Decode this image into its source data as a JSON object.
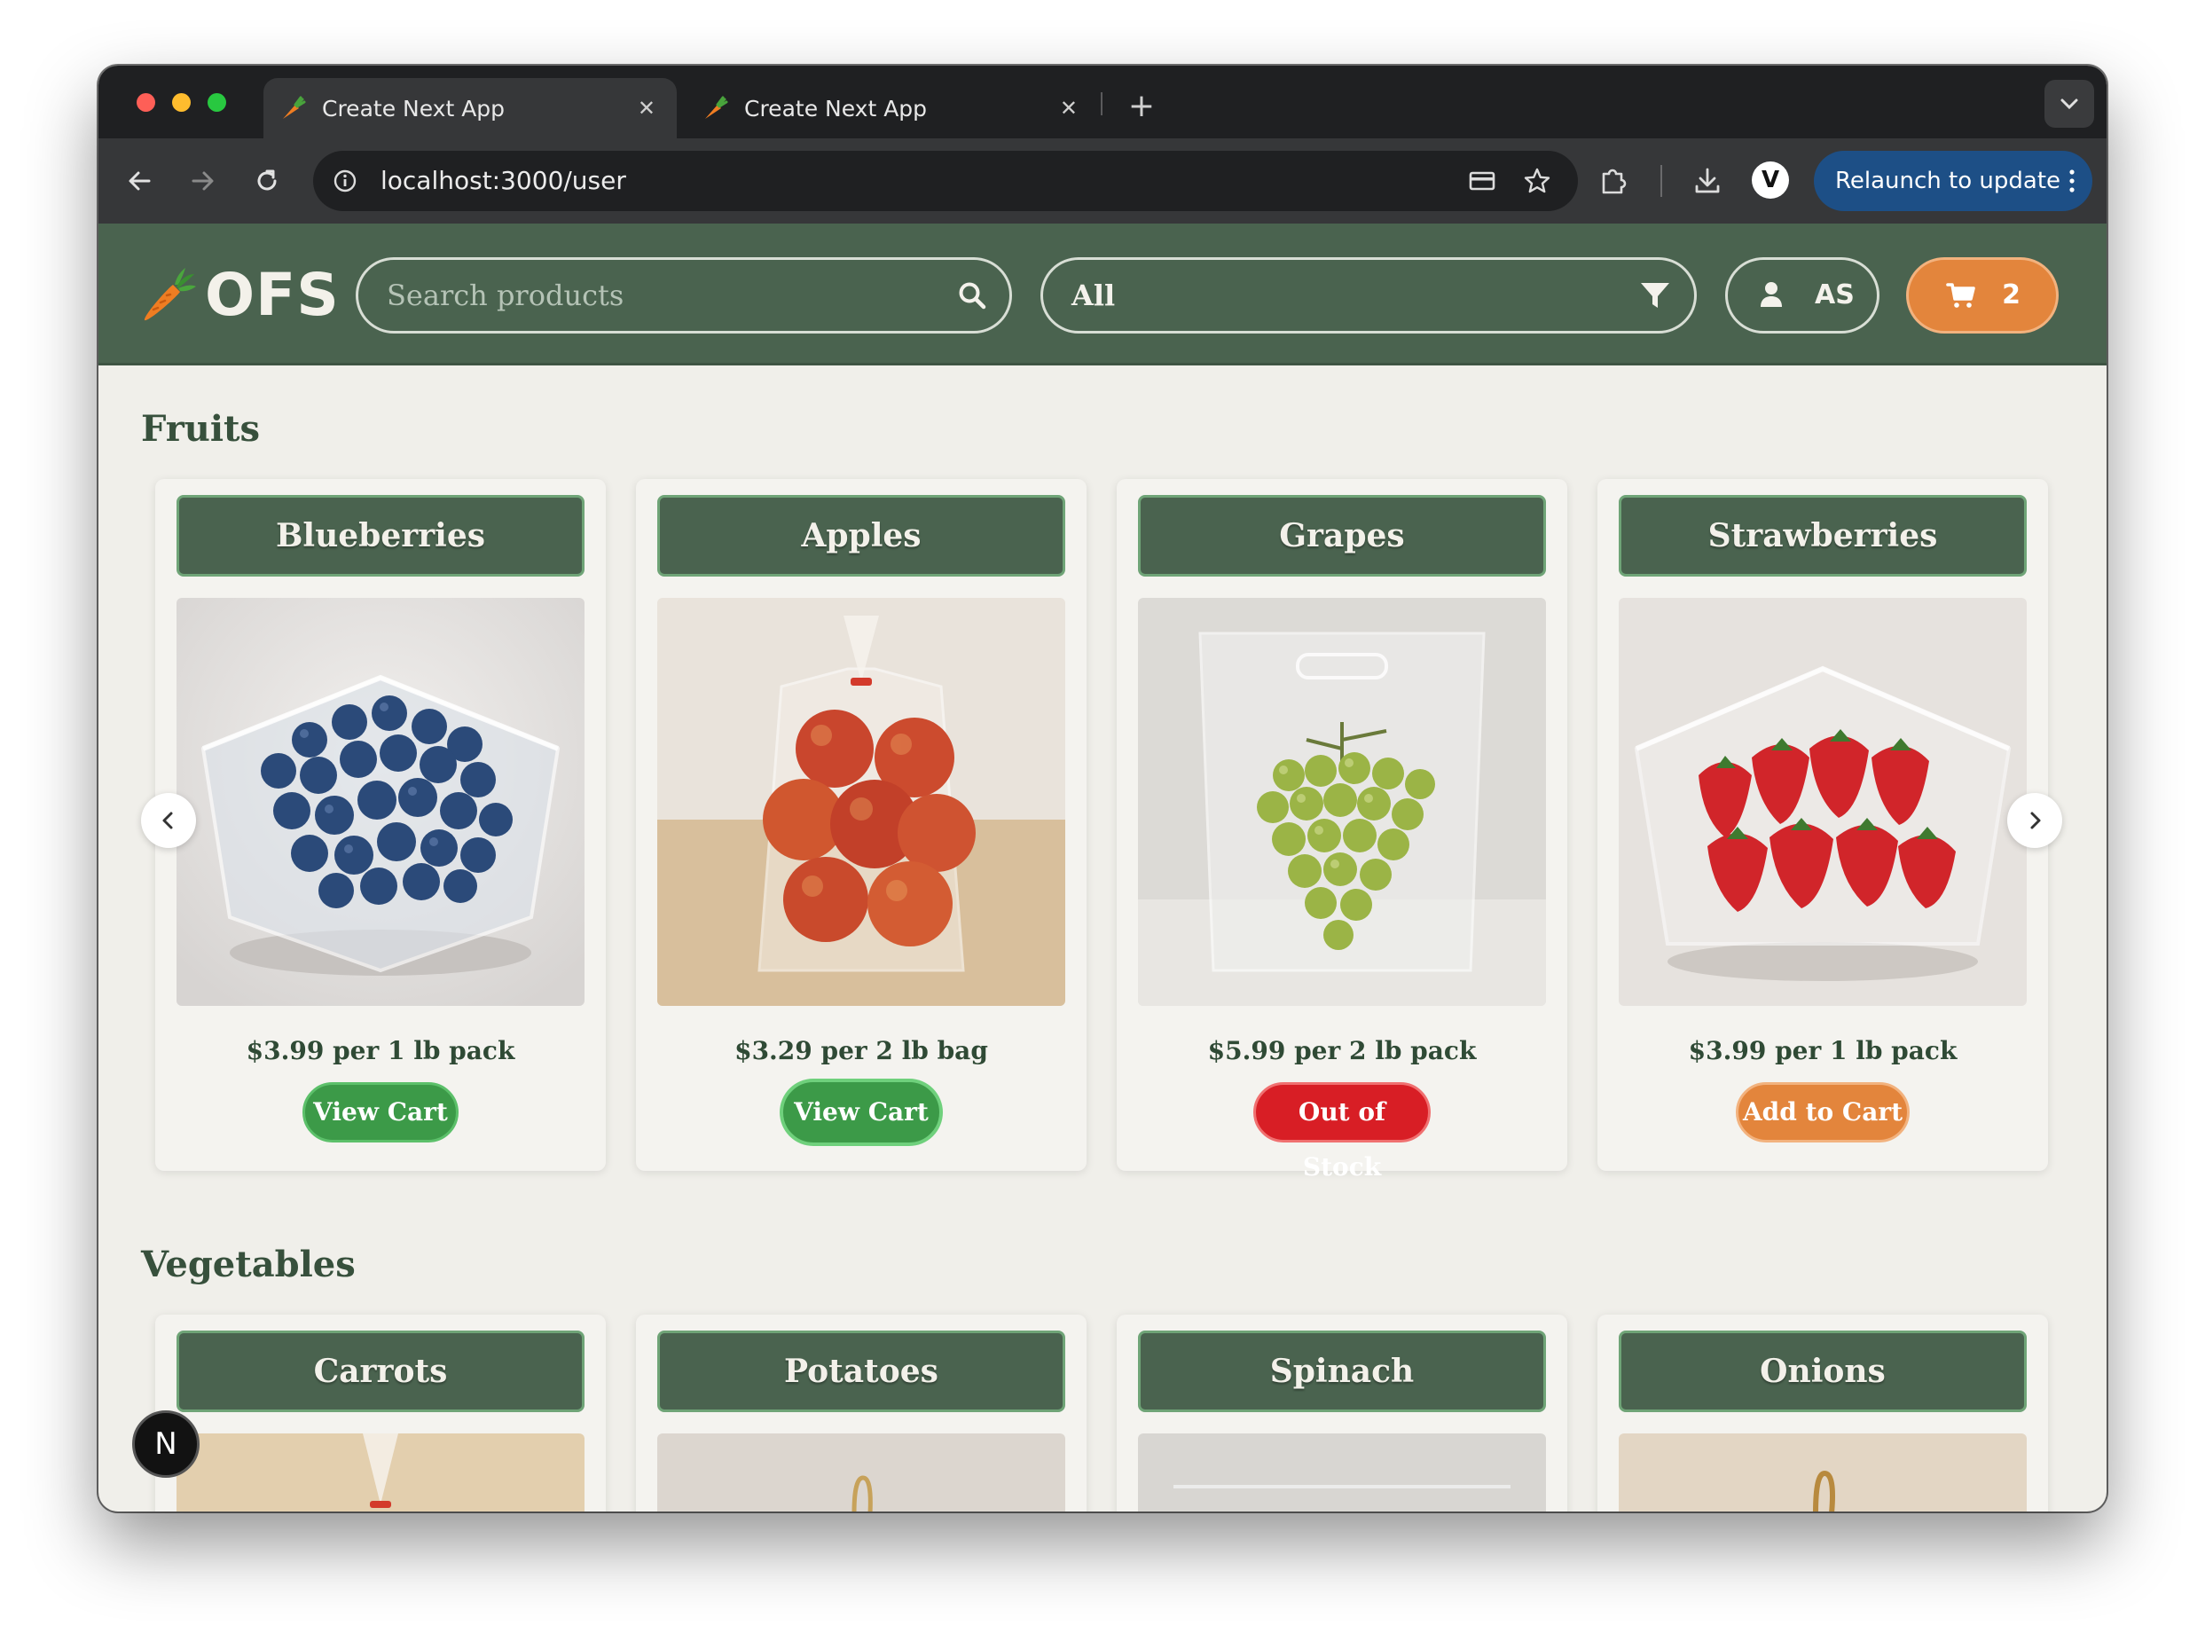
{
  "browser": {
    "tabs": [
      {
        "title": "Create Next App",
        "active": true
      },
      {
        "title": "Create Next App",
        "active": false
      }
    ],
    "address": "localhost:3000/user",
    "relaunch_label": "Relaunch to update",
    "profile_initial": "V"
  },
  "header": {
    "logo_text": "OFS",
    "search_placeholder": "Search products",
    "category_value": "All",
    "user_initials": "AS",
    "cart_count": "2"
  },
  "sections": [
    {
      "title": "Fruits",
      "products": [
        {
          "name": "Blueberries",
          "price": "$3.99 per 1 lb pack",
          "action": "View Cart",
          "action_state": "in-cart"
        },
        {
          "name": "Apples",
          "price": "$3.29 per 2 lb bag",
          "action": "View Cart",
          "action_state": "in-cart-focused"
        },
        {
          "name": "Grapes",
          "price": "$5.99 per 2 lb pack",
          "action": "Out of Stock",
          "action_state": "out-of-stock"
        },
        {
          "name": "Strawberries",
          "price": "$3.99 per 1 lb pack",
          "action": "Add to Cart",
          "action_state": "available"
        }
      ]
    },
    {
      "title": "Vegetables",
      "products": [
        {
          "name": "Carrots"
        },
        {
          "name": "Potatoes"
        },
        {
          "name": "Spinach"
        },
        {
          "name": "Onions"
        }
      ]
    }
  ],
  "dev_badge": "N",
  "colors": {
    "header_green": "#4a634f",
    "accent_orange": "#e3853c",
    "in_cart_green": "#3c9a48",
    "out_of_stock_red": "#d81e25",
    "page_background": "#f0efea"
  },
  "icons": {
    "search": "magnifier-icon",
    "filter": "funnel-icon",
    "user": "person-icon",
    "cart": "cart-icon",
    "carousel_prev": "chevron-left-icon",
    "carousel_next": "chevron-right-icon"
  }
}
